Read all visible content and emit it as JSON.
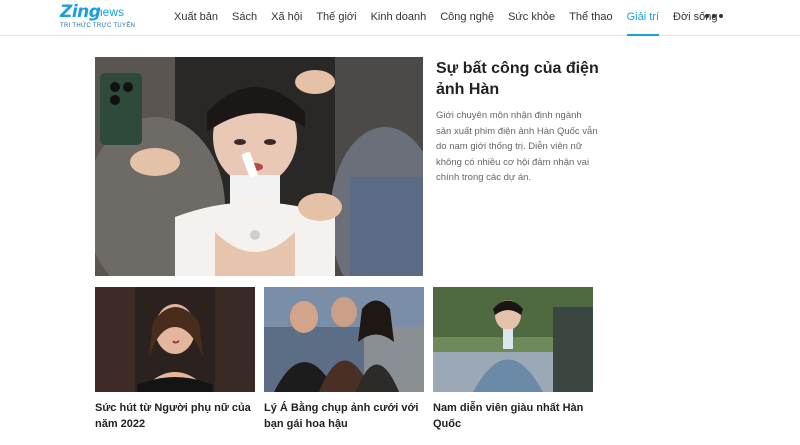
{
  "logo": {
    "main": "Zing",
    "news": "news",
    "tagline": "TRI THỨC TRỰC TUYẾN"
  },
  "nav": {
    "items": [
      {
        "label": "Xuất bản",
        "active": false
      },
      {
        "label": "Sách",
        "active": false
      },
      {
        "label": "Xã hội",
        "active": false
      },
      {
        "label": "Thế giới",
        "active": false
      },
      {
        "label": "Kinh doanh",
        "active": false
      },
      {
        "label": "Công nghệ",
        "active": false
      },
      {
        "label": "Sức khỏe",
        "active": false
      },
      {
        "label": "Thể thao",
        "active": false
      },
      {
        "label": "Giải trí",
        "active": true
      },
      {
        "label": "Đời sống",
        "active": false
      }
    ],
    "more_icon": "more-horizontal-icon"
  },
  "featured": {
    "title": "Sự bất công của điện ảnh Hàn",
    "description": "Giới chuyên môn nhận định ngành sản xuất phim điện ảnh Hàn Quốc vẫn do nam giới thống trị. Diễn viên nữ không có nhiều cơ hội đảm nhận vai chính trong các dự án."
  },
  "cards": [
    {
      "title": "Sức hút từ Người phụ nữ của năm 2022"
    },
    {
      "title": "Lý Á Bằng chụp ảnh cưới với bạn gái hoa hậu"
    },
    {
      "title": "Nam diễn viên giàu nhất Hàn Quốc"
    }
  ],
  "colors": {
    "accent": "#1a9fdc",
    "text": "#222222",
    "muted": "#666666"
  }
}
